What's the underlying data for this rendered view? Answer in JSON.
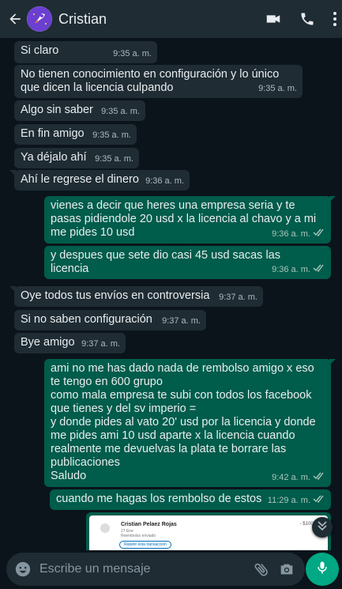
{
  "header": {
    "contact_name": "Cristian",
    "icons": [
      "back-arrow-icon",
      "avatar",
      "video-call-icon",
      "phone-icon",
      "more-options-icon"
    ]
  },
  "messages": [
    {
      "dir": "in",
      "text": "Si claro",
      "time": "9:35 a. m."
    },
    {
      "dir": "in",
      "text": "No tienen conocimiento en configuración y lo único\nque dicen la licencia culpando",
      "time": "9:35 a. m."
    },
    {
      "dir": "in",
      "text": "Algo sin saber",
      "time": "9:35 a. m."
    },
    {
      "dir": "in",
      "text": "En fin amigo",
      "time": "9:35 a. m."
    },
    {
      "dir": "in",
      "text": "Ya déjalo ahí",
      "time": "9:35 a. m."
    },
    {
      "dir": "in",
      "text": "Ahí le regrese el dinero",
      "time": "9:36 a. m."
    },
    {
      "dir": "out",
      "text": "vienes a decir que heres una empresa seria y   te\npasas pidiendole 20 usd x la licencia al chavo y a mi\nme pides 10 usd",
      "time": "9:36 a. m."
    },
    {
      "dir": "out",
      "text": "y despues que sete dio casi 45 usd  sacas las\nlicencia",
      "time": "9:36 a. m."
    },
    {
      "dir": "in",
      "text": "Oye todos tus envíos en controversia",
      "time": "9:37 a. m."
    },
    {
      "dir": "in",
      "text": "Si no saben configuración",
      "time": "9:37 a. m."
    },
    {
      "dir": "in",
      "text": "Bye amigo",
      "time": "9:37 a. m."
    },
    {
      "dir": "out",
      "text": "ami no me has dado nada de rembolso amigo x eso\nte tengo  en 600 grupo\ncomo mala empresa  te subi con todos los facebook\nque tienes  y del sv imperio =\ny donde pides al vato 20' usd por la licencia y donde\nme pides ami 10 usd aparte x la licencia  cuando\nrealmente me devuelvas la plata te borrare las\npublicaciones\nSaludo",
      "time": "9:42 a. m."
    },
    {
      "dir": "out",
      "text": "cuando me hagas los rembolso de estos",
      "time": "11:29 a. m."
    }
  ],
  "image_message": {
    "name": "Cristian Pelaez Rojas",
    "line1": "27 Ene",
    "line2": "Reembolso enviado",
    "amount": "- $100,00",
    "button": "Repetir esta transacción"
  },
  "input": {
    "placeholder": "Escribe un mensaje"
  },
  "colors": {
    "background": "#0b141a",
    "incoming_bubble": "#1f2c34",
    "outgoing_bubble": "#005c4b",
    "accent": "#00a884"
  }
}
